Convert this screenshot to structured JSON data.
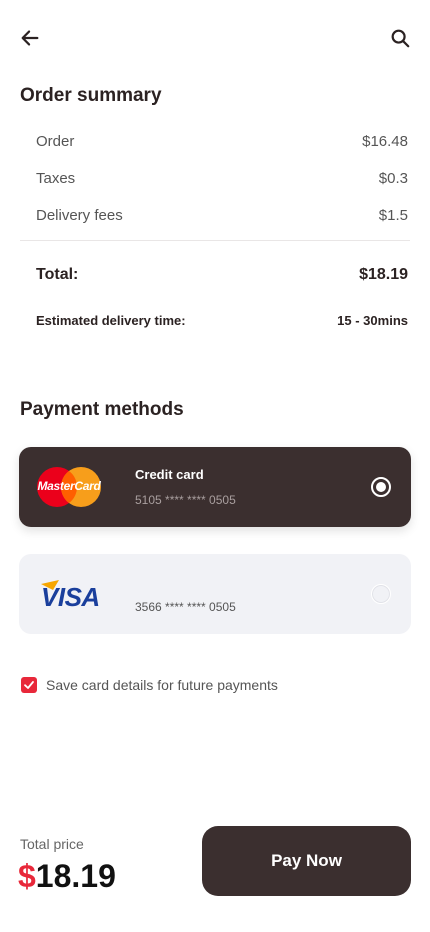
{
  "header": {
    "back_icon": "arrow-left-icon",
    "search_icon": "search-icon"
  },
  "order_summary": {
    "title": "Order summary",
    "rows": [
      {
        "label": "Order",
        "value": "$16.48"
      },
      {
        "label": "Taxes",
        "value": "$0.3"
      },
      {
        "label": "Delivery fees",
        "value": "$1.5"
      }
    ],
    "total_label": "Total:",
    "total_value": "$18.19",
    "delivery_time_label": "Estimated delivery time:",
    "delivery_time_value": "15 - 30mins"
  },
  "payment": {
    "title": "Payment methods",
    "cards": [
      {
        "brand": "MasterCard",
        "title": "Credit card",
        "number": "5105 **** **** 0505",
        "selected": true
      },
      {
        "brand": "VISA",
        "title": "",
        "number": "3566 **** **** 0505",
        "selected": false
      }
    ],
    "save_card_label": "Save card details for future payments",
    "save_card_checked": true
  },
  "footer": {
    "total_price_label": "Total price",
    "currency_symbol": "$",
    "total_amount": "18.19",
    "pay_button_label": "Pay Now"
  },
  "colors": {
    "accent": "#e8283a",
    "dark": "#3b2f2f",
    "light_card": "#f1f2f6"
  }
}
